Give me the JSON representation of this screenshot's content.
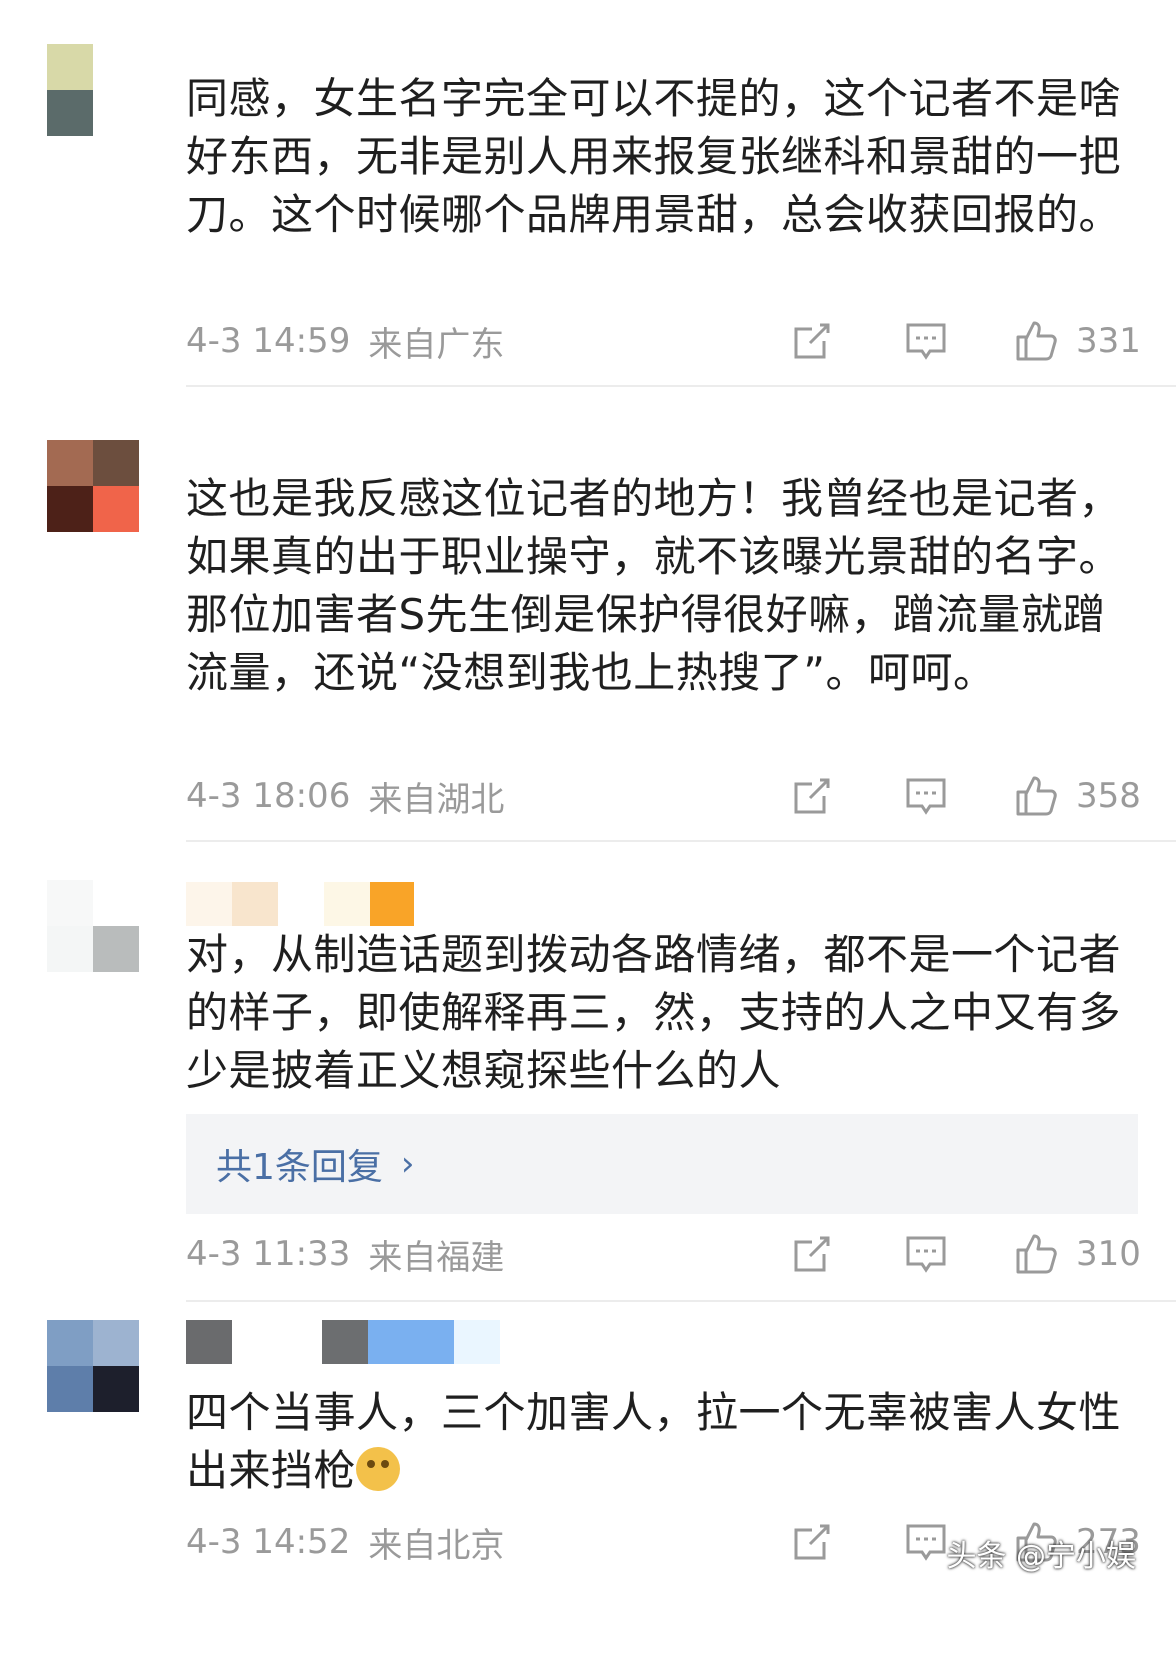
{
  "comments": [
    {
      "text": "同感，女生名字完全可以不提的，这个记者不是啥好东西，无非是别人用来报复张继科和景甜的一把刀。这个时候哪个品牌用景甜，总会收获回报的。",
      "time": "4-3 14:59",
      "location": "来自广东",
      "likes": "331",
      "avatar_colors": [
        "#d8d9a8",
        "#ffffff",
        "#5b6b6a",
        "#ffffff"
      ],
      "name_colors": []
    },
    {
      "text": "这也是我反感这位记者的地方！我曾经也是记者，如果真的出于职业操守，就不该曝光景甜的名字。那位加害者S先生倒是保护得很好嘛，蹭流量就蹭流量，还说“没想到我也上热搜了”。呵呵。",
      "time": "4-3 18:06",
      "location": "来自湖北",
      "likes": "358",
      "avatar_colors": [
        "#a36a52",
        "#6c4e3e",
        "#4d2118",
        "#f0644a"
      ],
      "name_colors": []
    },
    {
      "text": "对，从制造话题到拨动各路情绪，都不是一个记者的样子，即使解释再三，然，支持的人之中又有多少是披着正义想窥探些什么的人",
      "time": "4-3 11:33",
      "location": "来自福建",
      "likes": "310",
      "reply_summary": "共1条回复",
      "avatar_colors": [
        "#f7f8f8",
        "#ffffff",
        "#f4f6f6",
        "#b9bcbc"
      ],
      "name_colors": [
        "#fdf5ea",
        "#f8e5cd",
        "#ffffff",
        "#fdf7e6",
        "#f9a428"
      ]
    },
    {
      "text": "四个当事人，三个加害人，拉一个无辜被害人女性出来挡枪",
      "time": "4-3 14:52",
      "location": "来自北京",
      "likes": "273",
      "avatar_colors": [
        "#7f9ec4",
        "#9db3d0",
        "#5e7eaa",
        "#1d1f2c"
      ],
      "name_colors": [
        "#6a6b6d",
        "#ffffff",
        "#6c6e70",
        "#7ab0f0",
        "#eaf6ff"
      ]
    }
  ],
  "watermark": "头条 @宁小娱"
}
